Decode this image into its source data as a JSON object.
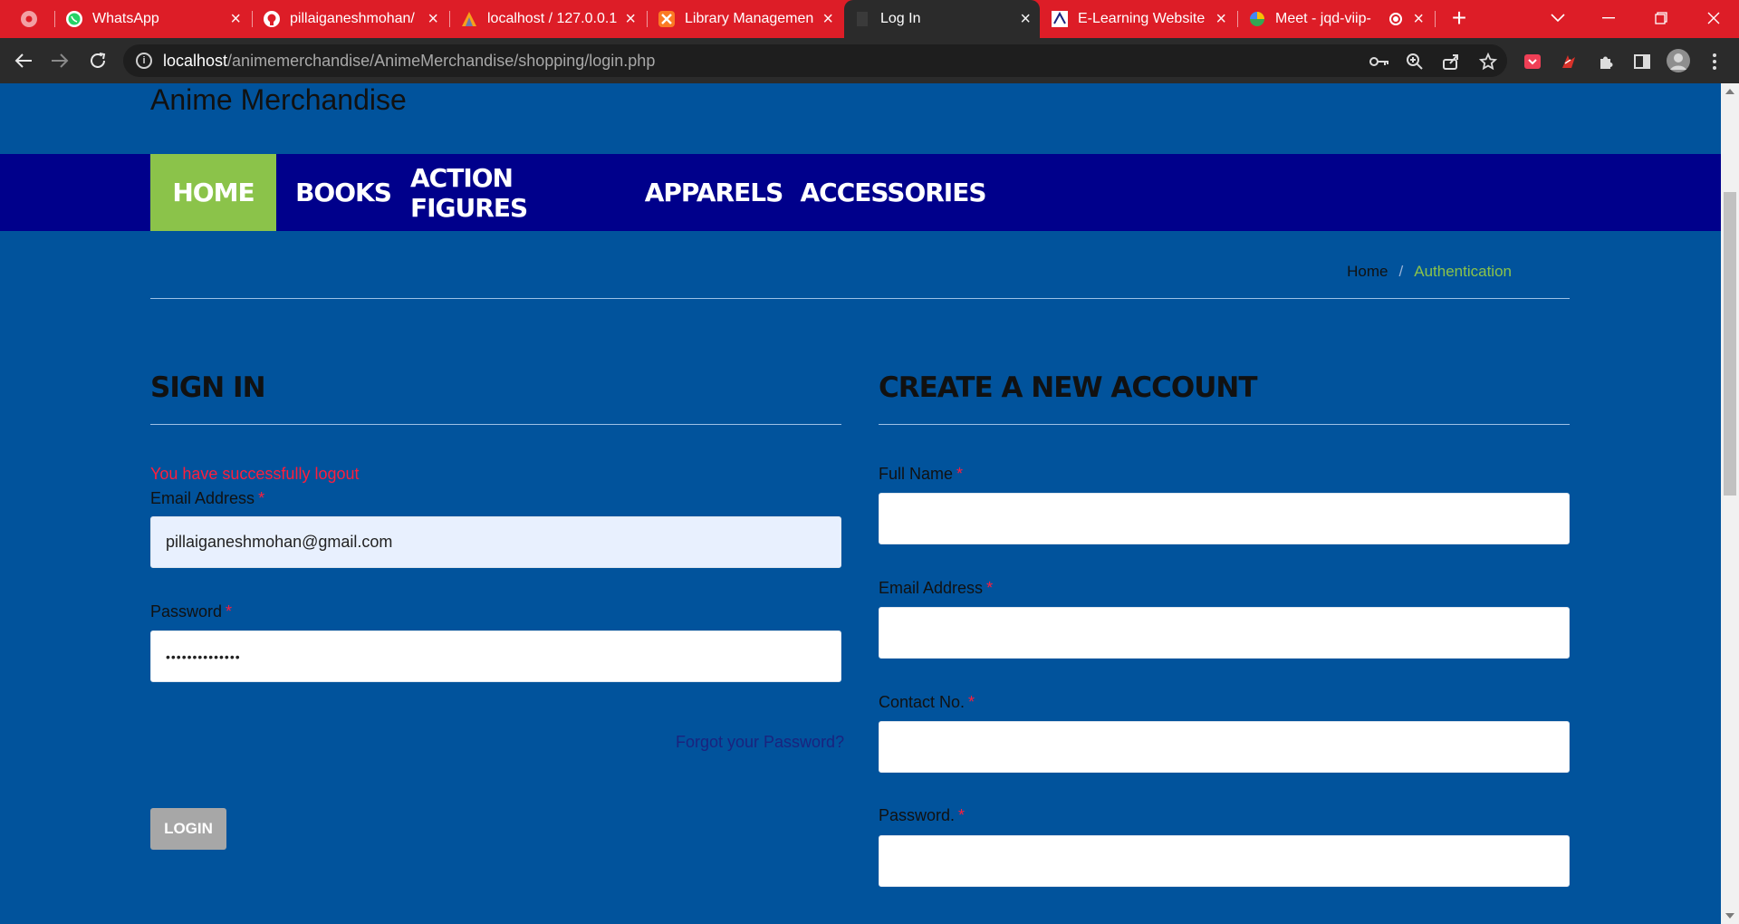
{
  "browser": {
    "tabs": [
      {
        "label": "",
        "icon": "chrome-icon"
      },
      {
        "label": "WhatsApp",
        "icon": "whatsapp-icon"
      },
      {
        "label": "pillaiganeshmohan/",
        "icon": "github-icon"
      },
      {
        "label": "localhost / 127.0.0.1",
        "icon": "phpmyadmin-icon"
      },
      {
        "label": "Library Managemen",
        "icon": "xampp-icon"
      },
      {
        "label": "Log In",
        "icon": "page-icon"
      },
      {
        "label": "E-Learning Website",
        "icon": "elearning-icon"
      },
      {
        "label": "Meet - jqd-viip-",
        "icon": "meet-icon"
      }
    ],
    "active_tab": 5,
    "url_host": "localhost",
    "url_path": "/animemerchandise/AnimeMerchandise/shopping/login.php",
    "tabbar_color": "#dd1d27"
  },
  "site": {
    "brand": "Anime Merchandise",
    "nav": [
      "HOME",
      "BOOKS",
      "ACTION FIGURES",
      "APPARELS",
      "ACCESSORIES"
    ],
    "active_nav": "HOME",
    "accent": "#8bc34a",
    "nav_bg": "#00008b",
    "page_bg": "#01539c"
  },
  "breadcrumb": {
    "home": "Home",
    "separator": "/",
    "current": "Authentication"
  },
  "signin": {
    "title": "SIGN IN",
    "alert": "You have successfully logout",
    "email_label": "Email Address",
    "email_value": "pillaiganeshmohan@gmail.com",
    "password_label": "Password",
    "password_value": "••••••••••••••",
    "forgot": "Forgot your Password?",
    "button": "LOGIN",
    "required_mark": "*"
  },
  "register": {
    "title": "CREATE A NEW ACCOUNT",
    "fullname_label": "Full Name",
    "email_label": "Email Address",
    "contact_label": "Contact No.",
    "password_label": "Password.",
    "required_mark": "*"
  }
}
